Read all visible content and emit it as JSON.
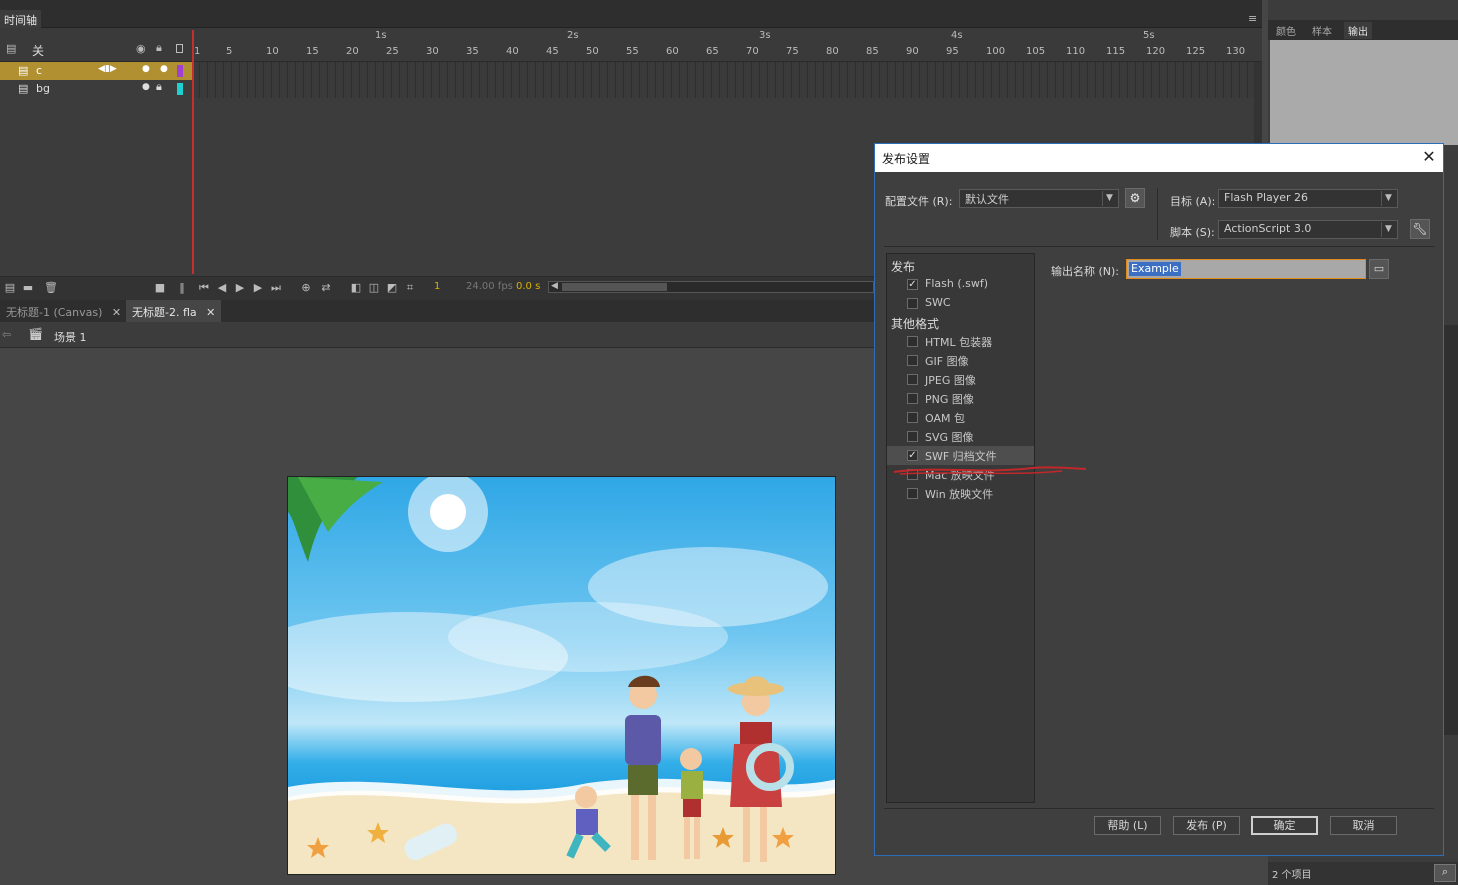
{
  "timeline": {
    "tab_label": "时间轴",
    "layer_header": "关",
    "seconds": [
      "1s",
      "2s",
      "3s",
      "4s",
      "5s"
    ],
    "frame_numbers": [
      "1",
      "5",
      "10",
      "15",
      "20",
      "25",
      "30",
      "35",
      "40",
      "45",
      "50",
      "55",
      "60",
      "65",
      "70",
      "75",
      "80",
      "85",
      "90",
      "95",
      "100",
      "105",
      "110",
      "115",
      "120",
      "125",
      "130"
    ],
    "layers": [
      {
        "name": "c",
        "selected": true,
        "color": "#a040d0"
      },
      {
        "name": "bg",
        "selected": false,
        "color": "#20d0d0"
      }
    ],
    "current_frame": "1",
    "fps": "24.00 fps",
    "time": "0.0 s"
  },
  "documents": {
    "tabs": [
      "无标题-1 (Canvas)",
      "无标题-2. fla"
    ],
    "scene": "场景 1"
  },
  "right_panel": {
    "tabs": [
      "颜色",
      "样本",
      "输出"
    ],
    "status": "2 个项目"
  },
  "dialog": {
    "title": "发布设置",
    "profile_label": "配置文件 (R):",
    "profile_value": "默认文件",
    "target_label": "目标 (A):",
    "target_value": "Flash Player 26",
    "script_label": "脚本 (S):",
    "script_value": "ActionScript 3.0",
    "section_publish": "发布",
    "publish_items": [
      {
        "label": "Flash (.swf)",
        "checked": true
      },
      {
        "label": "SWC",
        "checked": false
      }
    ],
    "section_other": "其他格式",
    "other_items": [
      {
        "label": "HTML 包装器",
        "checked": false
      },
      {
        "label": "GIF 图像",
        "checked": false
      },
      {
        "label": "JPEG 图像",
        "checked": false
      },
      {
        "label": "PNG 图像",
        "checked": false
      },
      {
        "label": "OAM 包",
        "checked": false
      },
      {
        "label": "SVG 图像",
        "checked": false
      },
      {
        "label": "SWF 归档文件",
        "checked": true
      },
      {
        "label": "Mac 放映文件",
        "checked": false
      },
      {
        "label": "Win 放映文件",
        "checked": false
      }
    ],
    "output_label": "输出名称 (N):",
    "output_value": "Example",
    "buttons": {
      "help": "帮助 (L)",
      "publish": "发布 (P)",
      "ok": "确定",
      "cancel": "取消"
    }
  },
  "colors": {
    "accent": "#2a6fb8",
    "playhead": "#c43030",
    "focus": "#e08a1a"
  }
}
